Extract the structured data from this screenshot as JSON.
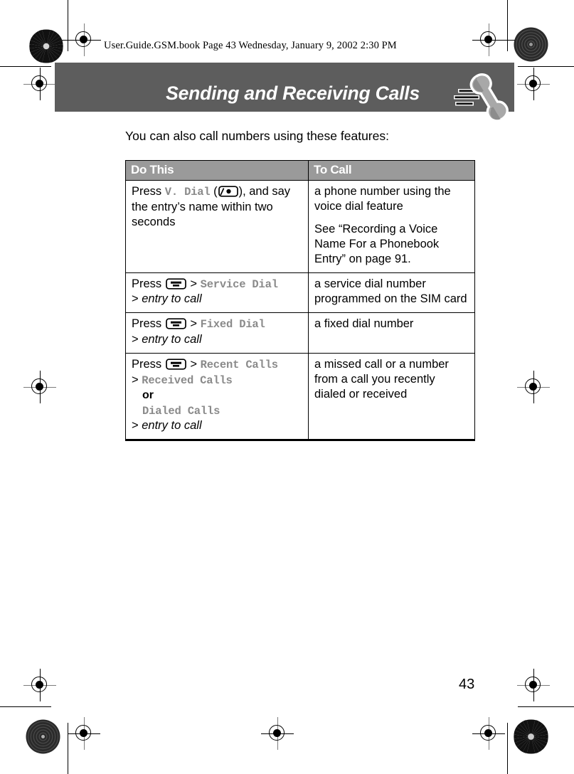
{
  "document": {
    "running_header": "User.Guide.GSM.book  Page 43  Wednesday, January 9, 2002  2:30 PM",
    "chapter_title": "Sending and Receiving Calls",
    "chapter_icon": "phone-handset-icon",
    "page_number": "43",
    "intro_text": "You can also call numbers using these features:"
  },
  "colors": {
    "banner_background": "#5d5d5d",
    "table_header_background": "#9a9a9a",
    "monospace_key_text": "#8a8a8a",
    "page_background": "#ffffff",
    "rule_color": "#000000"
  },
  "table": {
    "columns": [
      "Do This",
      "To Call"
    ],
    "rows": [
      {
        "do_this": {
          "press_label": "Press",
          "command": "V. Dial",
          "key_icon": "voice-dial-key-icon",
          "tail": "), and say the entry’s name within two seconds",
          "open_paren": "(",
          "close_paren": ")"
        },
        "to_call": [
          "a phone number using the voice dial feature",
          "See “Recording a Voice Name For a Phonebook Entry” on page 91."
        ]
      },
      {
        "do_this": {
          "press_label": "Press",
          "key_icon": "menu-key-icon",
          "path": [
            "Service Dial"
          ],
          "entry_line": "entry to call",
          "separator": ">"
        },
        "to_call": [
          "a service dial number programmed on the SIM card"
        ]
      },
      {
        "do_this": {
          "press_label": "Press",
          "key_icon": "menu-key-icon",
          "path": [
            "Fixed Dial"
          ],
          "entry_line": "entry to call",
          "separator": ">"
        },
        "to_call": [
          "a fixed dial number"
        ]
      },
      {
        "do_this": {
          "press_label": "Press",
          "key_icon": "menu-key-icon",
          "path": [
            "Recent Calls",
            "Received Calls",
            "Dialed Calls"
          ],
          "or_label": "or",
          "entry_line": "entry to call",
          "separator": ">"
        },
        "to_call": [
          "a missed call or a number from a call you recently dialed or received"
        ]
      }
    ]
  }
}
